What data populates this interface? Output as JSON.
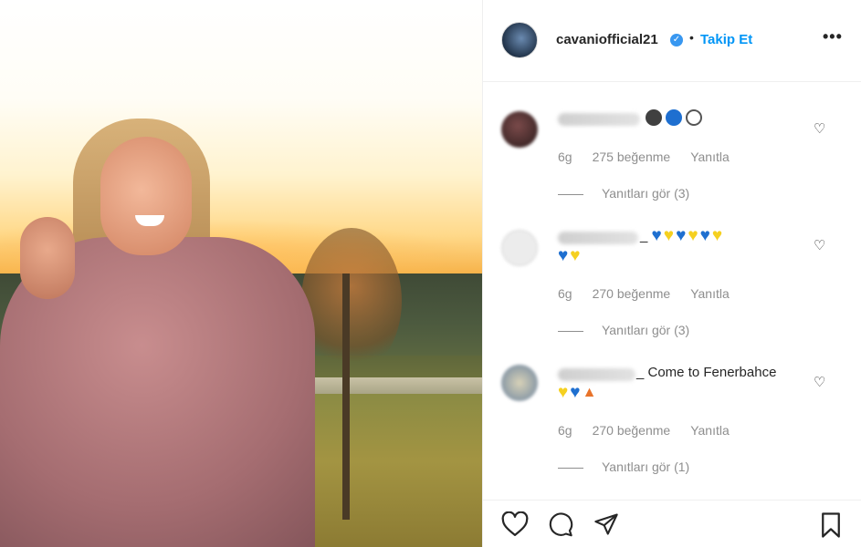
{
  "post": {
    "username": "cavaniofficial21",
    "separator": "•",
    "follow_label": "Takip Et",
    "more_label": "•••"
  },
  "comments": [
    {
      "extra_text": "",
      "emojis": [
        "black-circle",
        "blue-circle",
        "white-circle"
      ],
      "time": "6g",
      "likes": "275 beğenme",
      "reply": "Yanıtla",
      "view_replies": "Yanıtları gör (3)"
    },
    {
      "extra_text": "_",
      "emojis": [
        "blue-heart",
        "yellow-heart",
        "blue-heart",
        "yellow-heart",
        "blue-heart",
        "yellow-heart",
        "blue-heart",
        "yellow-heart"
      ],
      "time": "6g",
      "likes": "270 beğenme",
      "reply": "Yanıtla",
      "view_replies": "Yanıtları gör (3)"
    },
    {
      "extra_text": "_ Come to Fenerbahce",
      "emojis": [
        "yellow-heart",
        "blue-heart",
        "fire"
      ],
      "time": "6g",
      "likes": "270 beğenme",
      "reply": "Yanıtla",
      "view_replies": "Yanıtları gör (1)"
    }
  ],
  "colors": {
    "accent": "#0095f6",
    "verified": "#3897f0",
    "muted_text": "#8e8e8e",
    "emoji_blue": "#1e6fd0",
    "emoji_yellow": "#f5d020"
  }
}
